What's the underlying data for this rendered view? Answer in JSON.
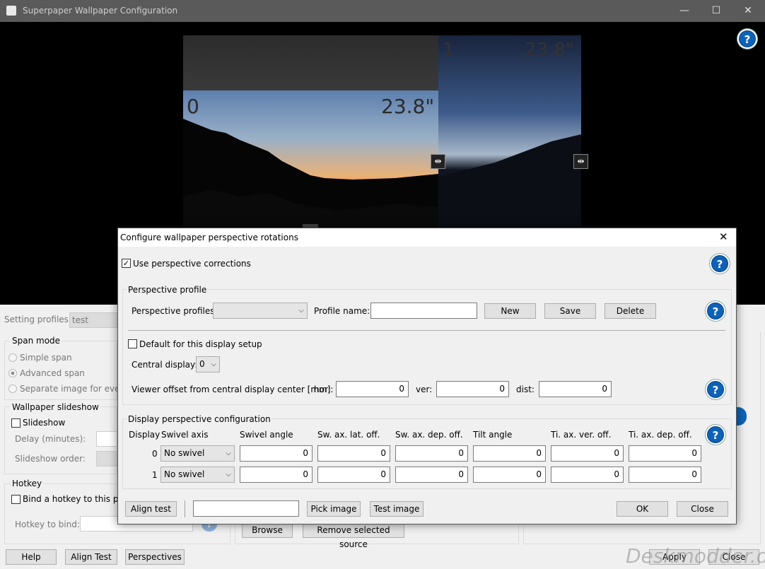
{
  "window": {
    "title": "Superpaper Wallpaper Configuration",
    "minimize": "—",
    "maximize": "☐",
    "close": "✕"
  },
  "preview": {
    "displays": [
      {
        "index": "0",
        "size": "23.8\""
      },
      {
        "index": "1",
        "size": "23.8\""
      }
    ]
  },
  "bg": {
    "setting_profiles_label": "Setting profiles:",
    "setting_profiles_value": "test",
    "span_mode": {
      "title": "Span mode",
      "simple": "Simple span",
      "advanced": "Advanced span",
      "separate": "Separate image for every d"
    },
    "slideshow": {
      "title": "Wallpaper slideshow",
      "checkbox": "Slideshow",
      "delay": "Delay (minutes):",
      "order": "Slideshow order:"
    },
    "hotkey": {
      "title": "Hotkey",
      "bind": "Bind a hotkey to this prof",
      "hotkey_to_bind": "Hotkey to bind:"
    },
    "sources": {
      "browse": "Browse",
      "remove": "Remove selected source"
    },
    "bottom": {
      "help": "Help",
      "align_test": "Align Test",
      "perspectives": "Perspectives",
      "apply": "Apply",
      "close": "Close"
    },
    "watermark": "Deskmodder.de"
  },
  "dialog": {
    "title": "Configure wallpaper perspective rotations",
    "close": "✕",
    "use_corrections": "Use perspective corrections",
    "use_corrections_checked": "✓",
    "profile_group": "Perspective profile",
    "profiles_label": "Perspective profiles:",
    "profiles_value": "",
    "profile_name_label": "Profile name:",
    "profile_name_value": "",
    "new": "New",
    "save": "Save",
    "delete": "Delete",
    "default_setup": "Default for this display setup",
    "central_label": "Central display:",
    "central_value": "0",
    "viewer_label": "Viewer offset from central display center [mm]:",
    "hor_label": "hor:",
    "hor_value": "0",
    "ver_label": "ver:",
    "ver_value": "0",
    "dist_label": "dist:",
    "dist_value": "0",
    "display_group": "Display perspective configuration",
    "columns": [
      "Display",
      "Swivel axis",
      "Swivel angle",
      "Sw. ax. lat. off.",
      "Sw. ax. dep. off.",
      "Tilt angle",
      "Ti. ax. ver. off.",
      "Ti. ax. dep. off."
    ],
    "rows": [
      {
        "display": "0",
        "swivel_axis": "No swivel",
        "values": [
          "0",
          "0",
          "0",
          "0",
          "0",
          "0"
        ]
      },
      {
        "display": "1",
        "swivel_axis": "No swivel",
        "values": [
          "0",
          "0",
          "0",
          "0",
          "0",
          "0"
        ]
      }
    ],
    "align_test": "Align test",
    "image_path": "",
    "pick_image": "Pick image",
    "test_image": "Test image",
    "ok": "OK",
    "close_btn": "Close",
    "help": "?"
  }
}
